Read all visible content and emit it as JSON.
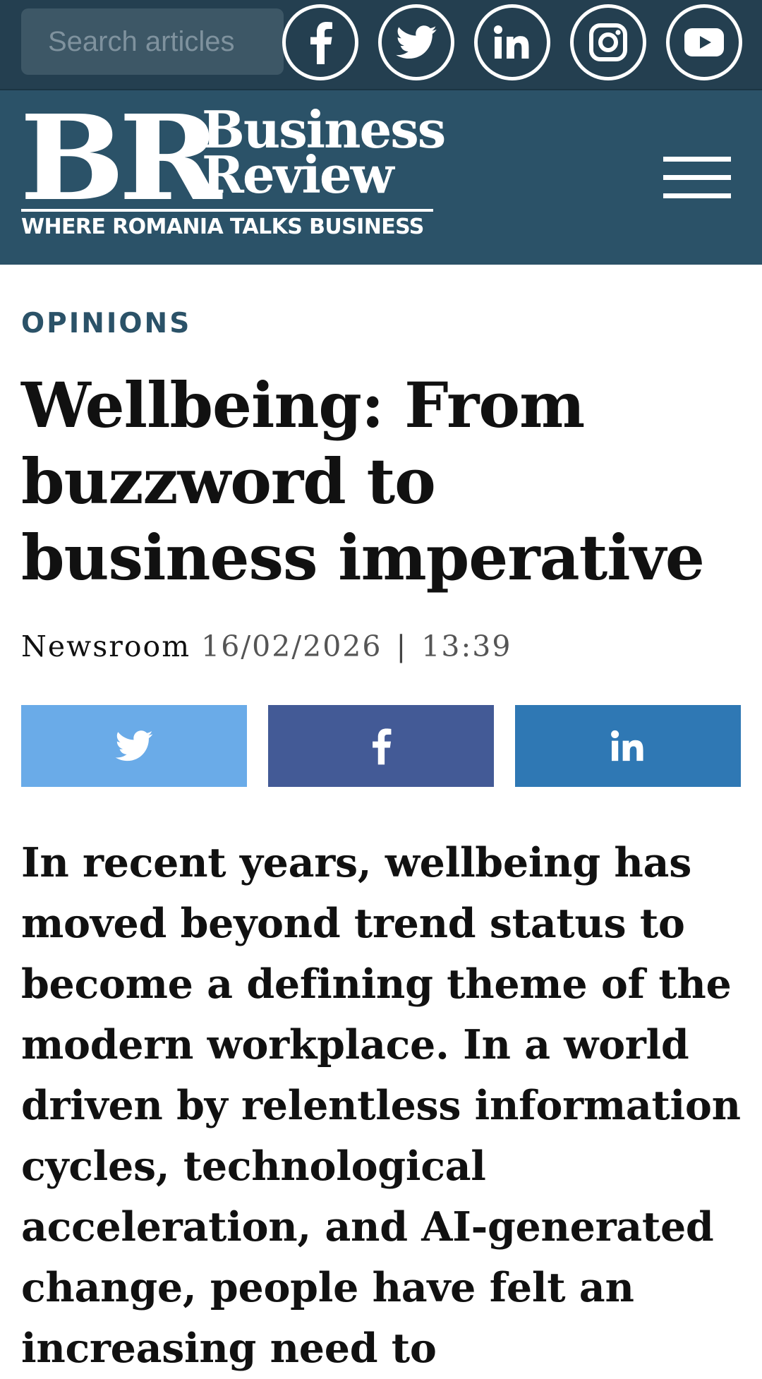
{
  "search": {
    "placeholder": "Search articles"
  },
  "social_icons": [
    {
      "name": "facebook-icon"
    },
    {
      "name": "twitter-icon"
    },
    {
      "name": "linkedin-icon"
    },
    {
      "name": "instagram-icon"
    },
    {
      "name": "youtube-icon"
    }
  ],
  "brand": {
    "logo_letters": "BR",
    "line1": "Business",
    "line2": "Review",
    "tagline": "WHERE ROMANIA TALKS BUSINESS",
    "colors": {
      "topbar": "#243f50",
      "header": "#2b5268"
    }
  },
  "menu": {
    "icon": "hamburger-menu-icon"
  },
  "article": {
    "category": "OPINIONS",
    "title": "Wellbeing: From buzzword to business imperative",
    "author": "Newsroom",
    "date": "16/02/2026",
    "separator": "|",
    "time": "13:39",
    "body": "In recent years, wellbeing has moved beyond trend status to become a defining theme of the modern workplace. In a world driven by relentless information cycles, technological acceleration, and AI-generated change, people have felt an increasing need to"
  },
  "share": {
    "twitter": {
      "icon": "twitter-icon",
      "color": "#6aabe8"
    },
    "facebook": {
      "icon": "facebook-icon",
      "color": "#435a96"
    },
    "linkedin": {
      "icon": "linkedin-icon",
      "label": "in",
      "color": "#2f78b4"
    }
  }
}
